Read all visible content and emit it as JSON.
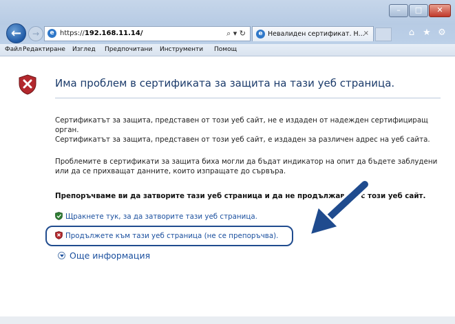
{
  "window": {
    "controls": [
      "minimize",
      "maximize",
      "close"
    ]
  },
  "nav": {
    "url_scheme": "https://",
    "url_host": "192.168.11.14/",
    "address_tools": "⌕ ▾ ↻"
  },
  "tab": {
    "title": "Невалиден сертификат. Н...",
    "close": "×"
  },
  "menu": {
    "items": [
      "Файл",
      "Редактиране",
      "Изглед",
      "Предпочитани",
      "Инструменти",
      "Помощ"
    ]
  },
  "page": {
    "headline": "Има проблем в сертификата за защита на тази уеб страница.",
    "p1": "Сертификатът за защита, представен от този уеб сайт, не е издаден от надежден сертифициращ орган.",
    "p2": "Сертификатът за защита, представен от този уеб сайт, е издаден за различен адрес на уеб сайта.",
    "p3": "Проблемите в сертификати за защита биха могли да бъдат индикатор на опит да бъдете заблудени или да се прихващат данните, които изпращате до сървъра.",
    "recommend": "Препоръчваме ви да затворите тази уеб страница и да не продължавате с този уеб сайт.",
    "close_link": "Щракнете тук, за да затворите тази уеб страница.",
    "continue_link": "Продължете към тази уеб страница (не се препоръчва).",
    "more_info": "Още информация"
  },
  "colors": {
    "arrow": "#1f4b8e",
    "shield": "#b3282d",
    "link": "#1a4f9e"
  }
}
